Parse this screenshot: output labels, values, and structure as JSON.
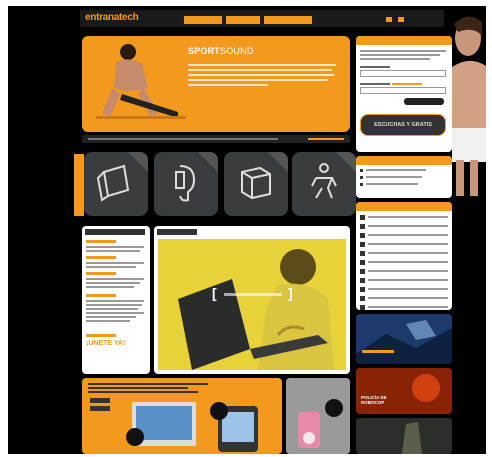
{
  "brand": {
    "logo": "entranatech"
  },
  "nav": {
    "tabs": [
      "",
      "",
      ""
    ]
  },
  "hero": {
    "title_bold": "SPORT",
    "title_thin": "SOUND"
  },
  "sections": {
    "icon_labels": [
      "",
      "",
      "",
      ""
    ]
  },
  "login": {
    "submit_label": "ESCUCHAS Y GRATIS"
  },
  "video": {
    "play_bracket_left": "[",
    "play_bracket_right": "]"
  },
  "left_column": {
    "cta": "¡ÚNETE YA!"
  },
  "bottom": {
    "badge_text": ""
  },
  "ads": {
    "ad2_title": "POLICÍA DE ROBOCOP",
    "ad3_title": ""
  },
  "colors": {
    "accent": "#f39a1e",
    "background": "#000000",
    "panel": "#ffffff",
    "video_panel": "#e8d23a"
  }
}
